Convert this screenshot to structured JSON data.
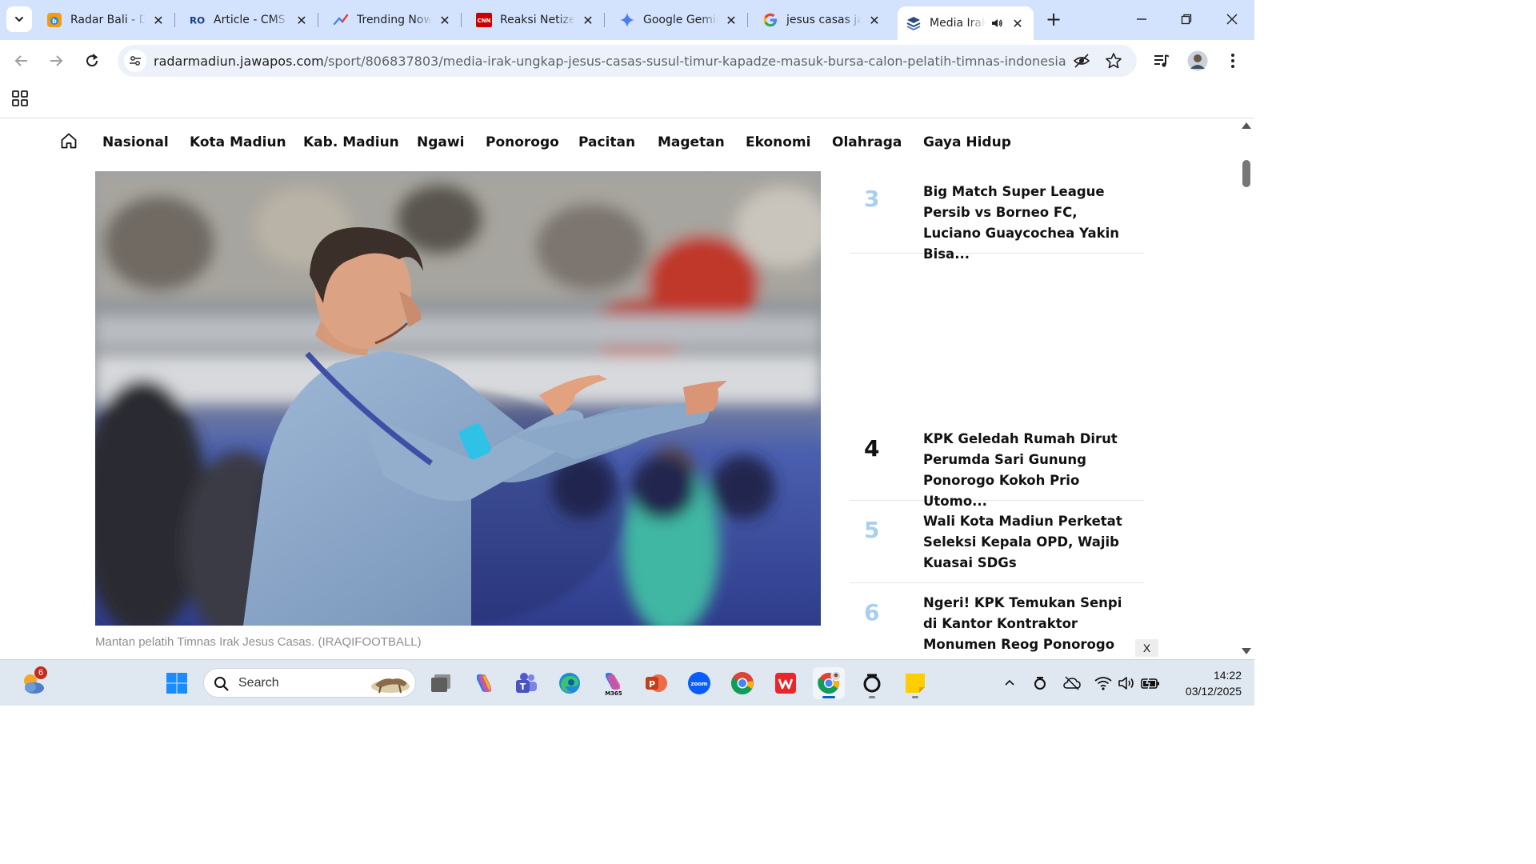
{
  "tabs": [
    {
      "title": "Radar Bali - D",
      "icon": "radar-bali-favicon",
      "active": false
    },
    {
      "title": "Article - CMS",
      "icon": "ro-cms-favicon",
      "active": false
    },
    {
      "title": "Trending Now",
      "icon": "trending-favicon",
      "active": false
    },
    {
      "title": "Reaksi Netizer",
      "icon": "cnn-favicon",
      "active": false
    },
    {
      "title": "Google Gemir",
      "icon": "gemini-favicon",
      "active": false
    },
    {
      "title": "jesus casas jav",
      "icon": "google-favicon",
      "active": false
    },
    {
      "title": "Media Irak",
      "icon": "jawapos-favicon",
      "active": true,
      "audio": true
    }
  ],
  "omnibox": {
    "domain": "radarmadiun.jawapos.com",
    "path": "/sport/806837803/media-irak-ungkap-jesus-casas-susul-timur-kapadze-masuk-bursa-calon-pelatih-timnas-indonesia"
  },
  "site_nav": [
    "Nasional",
    "Kota Madiun",
    "Kab. Madiun",
    "Ngawi",
    "Ponorogo",
    "Pacitan",
    "Magetan",
    "Ekonomi",
    "Olahraga",
    "Gaya Hidup"
  ],
  "hero": {
    "caption": "Mantan pelatih Timnas Irak Jesus Casas. (IRAQIFOOTBALL)"
  },
  "trending": [
    {
      "rank": "3",
      "headline": "Big Match Super League Persib vs Borneo FC, Luciano Guaycochea Yakin Bisa...",
      "rank_color": "#a9cfee"
    },
    {
      "rank": "4",
      "headline": "KPK Geledah Rumah Dirut Perumda Sari Gunung Ponorogo Kokoh Prio Utomo...",
      "rank_color": "#111111"
    },
    {
      "rank": "5",
      "headline": "Wali Kota Madiun Perketat Seleksi Kepala OPD, Wajib Kuasai SDGs",
      "rank_color": "#a9cfee"
    },
    {
      "rank": "6",
      "headline": "Ngeri! KPK Temukan Senpi di Kantor Kontraktor Monumen Reog Ponorogo",
      "rank_color": "#a9cfee"
    }
  ],
  "ad_close_label": "X",
  "taskbar": {
    "weather_badge": "6",
    "search_label": "Search",
    "time": "14:22",
    "date": "03/12/2025"
  },
  "colors": {
    "tabstrip": "#d3e3fd",
    "omnibox": "#edf2fa",
    "taskbar": "#dfe7f1",
    "trend_rank_light": "#a9cfee",
    "accent": "#0067c0"
  }
}
